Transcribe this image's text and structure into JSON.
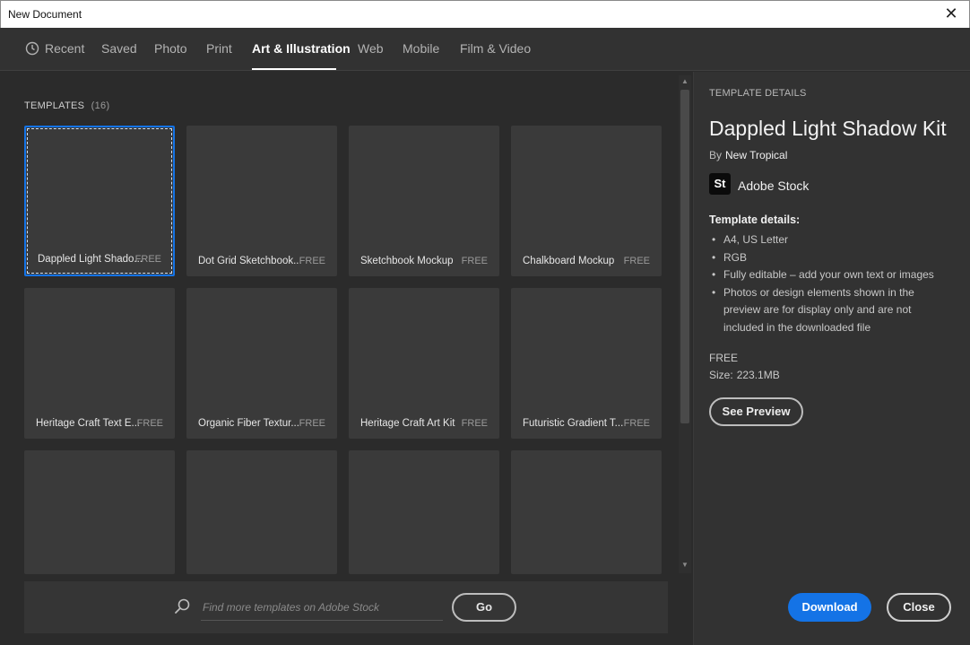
{
  "window": {
    "title": "New Document",
    "close_glyph": "✕"
  },
  "tabs": [
    {
      "label": "Recent",
      "icon": "clock-icon"
    },
    {
      "label": "Saved"
    },
    {
      "label": "Photo"
    },
    {
      "label": "Print"
    },
    {
      "label": "Art & Illustration",
      "active": true
    },
    {
      "label": "Web"
    },
    {
      "label": "Mobile"
    },
    {
      "label": "Film & Video"
    }
  ],
  "templates": {
    "heading": "TEMPLATES",
    "count": "(16)",
    "items": [
      {
        "name": "Dappled Light Shado...",
        "price": "FREE",
        "selected": true
      },
      {
        "name": "Dot Grid Sketchbook...",
        "price": "FREE"
      },
      {
        "name": "Sketchbook Mockup",
        "price": "FREE"
      },
      {
        "name": "Chalkboard Mockup",
        "price": "FREE"
      },
      {
        "name": "Heritage Craft Text E...",
        "price": "FREE"
      },
      {
        "name": "Organic Fiber Textur...",
        "price": "FREE"
      },
      {
        "name": "Heritage Craft Art Kit",
        "price": "FREE"
      },
      {
        "name": "Futuristic Gradient T...",
        "price": "FREE"
      },
      {
        "name": "",
        "price": ""
      },
      {
        "name": "",
        "price": ""
      },
      {
        "name": "",
        "price": ""
      },
      {
        "name": "",
        "price": ""
      }
    ]
  },
  "search": {
    "placeholder": "Find more templates on Adobe Stock",
    "go_label": "Go"
  },
  "details": {
    "section_label": "TEMPLATE DETAILS",
    "title": "Dappled Light Shadow Kit",
    "by_label": "By",
    "author": "New Tropical",
    "stock_badge": "St",
    "stock_name": "Adobe Stock",
    "subhead": "Template details:",
    "bullets": [
      "A4, US Letter",
      "RGB",
      "Fully editable – add your own text or images",
      "Photos or design elements shown in the preview are for display only and are not included in the downloaded file"
    ],
    "price": "FREE",
    "size_label": "Size:",
    "size_value": "223.1MB",
    "preview_label": "See Preview"
  },
  "footer": {
    "download_label": "Download",
    "close_label": "Close"
  },
  "colors": {
    "accent": "#1473e6",
    "background": "#2b2b2b",
    "panel": "#323232",
    "tile": "#3a3a3a"
  }
}
